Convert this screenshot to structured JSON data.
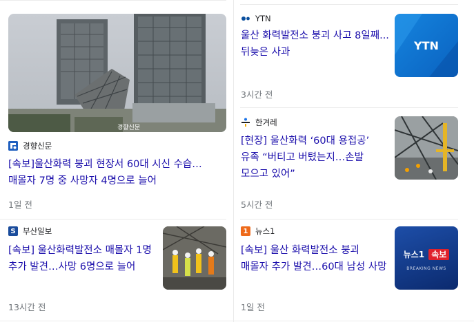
{
  "cards": [
    {
      "source": "경향신문",
      "title": "[속보]울산화력 붕괴 현장서 60대 시신 수습…매몰자 7명 중 사망자 4명으로 늘어",
      "time": "1일 전",
      "image_caption": "경향신문",
      "logo_text": "경"
    },
    {
      "source": "YTN",
      "title": "울산 화력발전소 붕괴 사고 8일째...뒤늦은 사과",
      "time": "3시간 전",
      "image_caption": "YTN"
    },
    {
      "source": "한겨레",
      "title": "[현장] 울산화력 ‘60대 용접공’ 유족 “버티고 버텼는지…손발 모으고 있어”",
      "time": "5시간 전"
    },
    {
      "source": "부산일보",
      "title": "[속보] 울산화력발전소 매몰자 1명 추가 발견…사망 6명으로 늘어",
      "time": "13시간 전",
      "logo_text": "S"
    },
    {
      "source": "뉴스1",
      "title": "[속보] 울산 화력발전소 붕괴 매몰자 추가 발견…60대 남성 사망",
      "time": "1일 전",
      "logo_text": "1",
      "thumb_badge": {
        "brand": "뉴스1",
        "tag": "속보",
        "sub": "BREAKING NEWS"
      }
    }
  ],
  "colors": {
    "title": "#1a0dab",
    "meta": "#70757a",
    "divider": "#ebebeb",
    "ytn_blue": "#0a7bd4"
  }
}
